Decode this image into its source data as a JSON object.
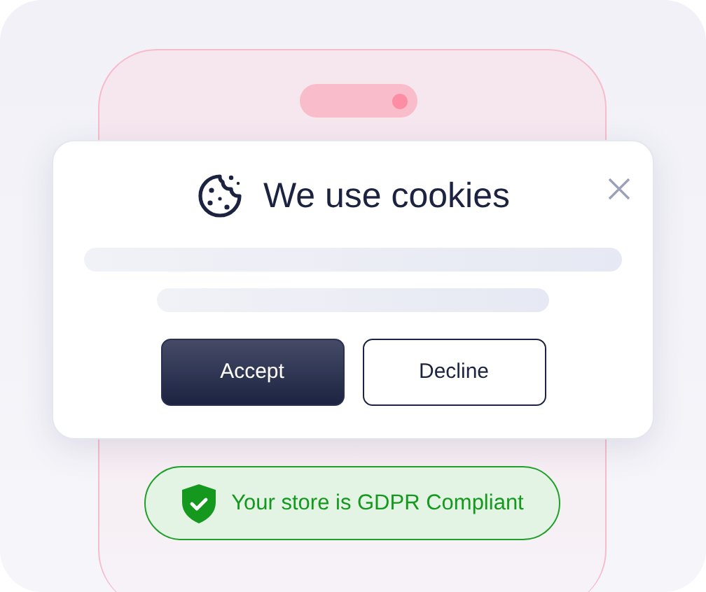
{
  "dialog": {
    "title": "We use cookies",
    "buttons": [
      {
        "label": "Accept",
        "kind": "primary"
      },
      {
        "label": "Decline",
        "kind": "outline"
      }
    ]
  },
  "badge": {
    "text": "Your store is GDPR Compliant"
  }
}
